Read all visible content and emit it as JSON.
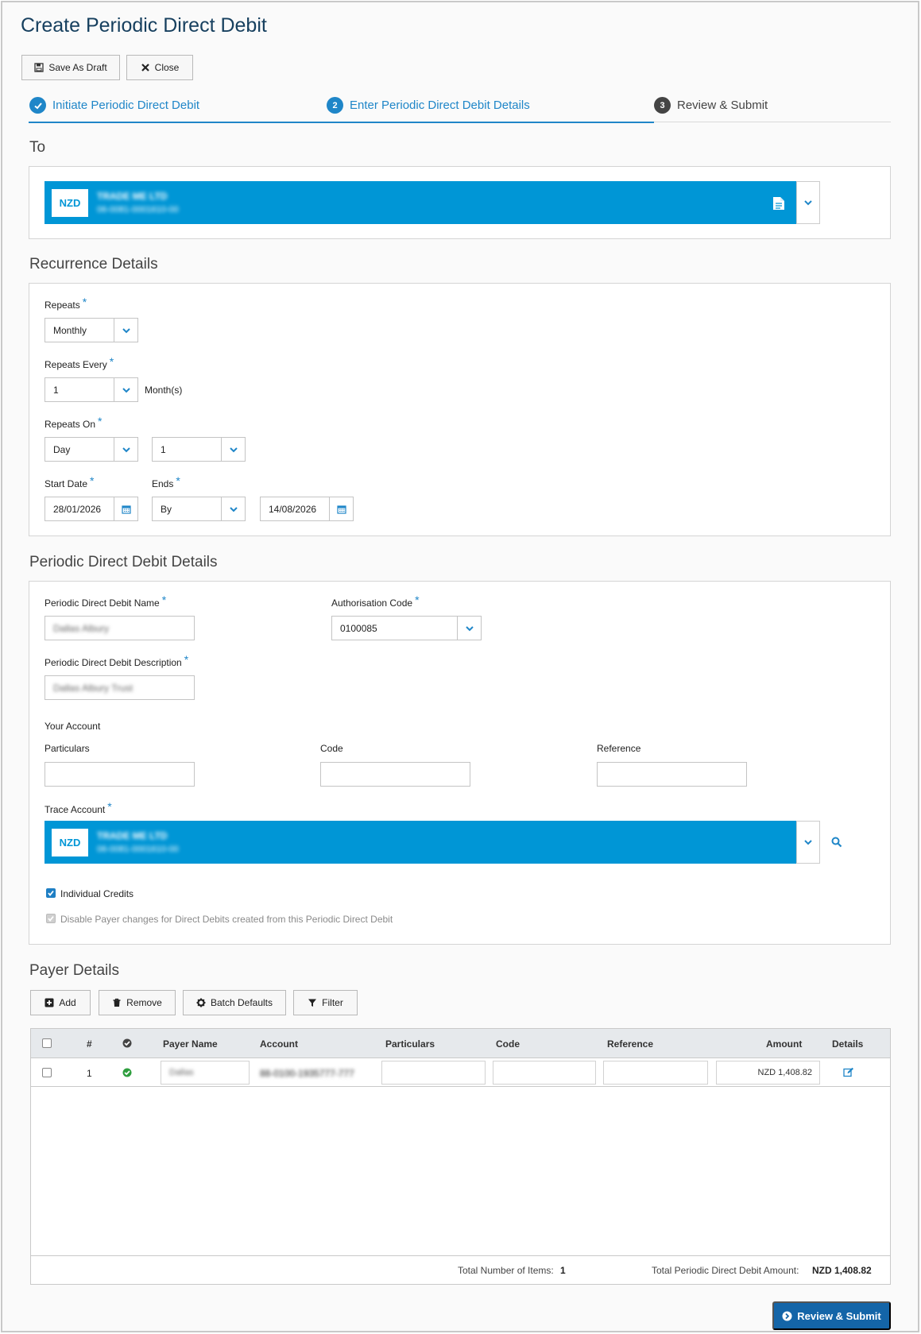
{
  "page": {
    "title": "Create Periodic Direct Debit"
  },
  "toolbar": {
    "save_draft_label": "Save As Draft",
    "close_label": "Close"
  },
  "steps": [
    {
      "number": "1",
      "label": "Initiate Periodic Direct Debit",
      "state": "done"
    },
    {
      "number": "2",
      "label": "Enter Periodic Direct Debit Details",
      "state": "active"
    },
    {
      "number": "3",
      "label": "Review & Submit",
      "state": "todo"
    }
  ],
  "to": {
    "section_title": "To",
    "currency": "NZD",
    "account_name": "TRADE ME LTD",
    "account_number": "06-0081-0001610-00"
  },
  "recurrence": {
    "section_title": "Recurrence Details",
    "repeats_label": "Repeats",
    "repeats_value": "Monthly",
    "repeats_every_label": "Repeats Every",
    "repeats_every_value": "1",
    "repeats_every_unit": "Month(s)",
    "repeats_on_label": "Repeats On",
    "repeats_on_type": "Day",
    "repeats_on_value": "1",
    "start_date_label": "Start Date",
    "start_date_value": "28/01/2026",
    "ends_label": "Ends",
    "ends_type": "By",
    "ends_date_value": "14/08/2026"
  },
  "details": {
    "section_title": "Periodic Direct Debit Details",
    "name_label": "Periodic Direct Debit Name",
    "name_value": "Dallas Albury",
    "auth_code_label": "Authorisation Code",
    "auth_code_value": "0100085",
    "description_label": "Periodic Direct Debit Description",
    "description_value": "Dallas Albury Trust",
    "your_account_label": "Your Account",
    "particulars_label": "Particulars",
    "particulars_value": "",
    "code_label": "Code",
    "code_value": "",
    "reference_label": "Reference",
    "reference_value": "",
    "trace_account_label": "Trace Account",
    "trace_currency": "NZD",
    "trace_account_name": "TRADE ME LTD",
    "trace_account_number": "06-0081-0001610-00",
    "individual_credits_label": "Individual Credits",
    "individual_credits_checked": true,
    "disable_payer_changes_label": "Disable Payer changes for Direct Debits created from this Periodic Direct Debit",
    "disable_payer_changes_checked": true
  },
  "payers": {
    "section_title": "Payer Details",
    "buttons": {
      "add": "Add",
      "remove": "Remove",
      "batch_defaults": "Batch Defaults",
      "filter": "Filter"
    },
    "columns": [
      "#",
      "Payer Name",
      "Account",
      "Particulars",
      "Code",
      "Reference",
      "Amount",
      "Details"
    ],
    "rows": [
      {
        "index": "1",
        "payer_name": "Dallas",
        "account": "88-0100-1935777-777",
        "particulars": "",
        "code": "",
        "reference": "",
        "amount": "NZD 1,408.82"
      }
    ],
    "total_items_label": "Total Number of Items:",
    "total_items_value": "1",
    "total_amount_label": "Total Periodic Direct Debit Amount:",
    "total_amount_value": "NZD 1,408.82"
  },
  "footer": {
    "review_submit_label": "Review & Submit"
  },
  "colors": {
    "accent": "#1f86c8",
    "account_bar": "#0096d6",
    "primary_button": "#1465a8",
    "success": "#2e9e3e"
  }
}
